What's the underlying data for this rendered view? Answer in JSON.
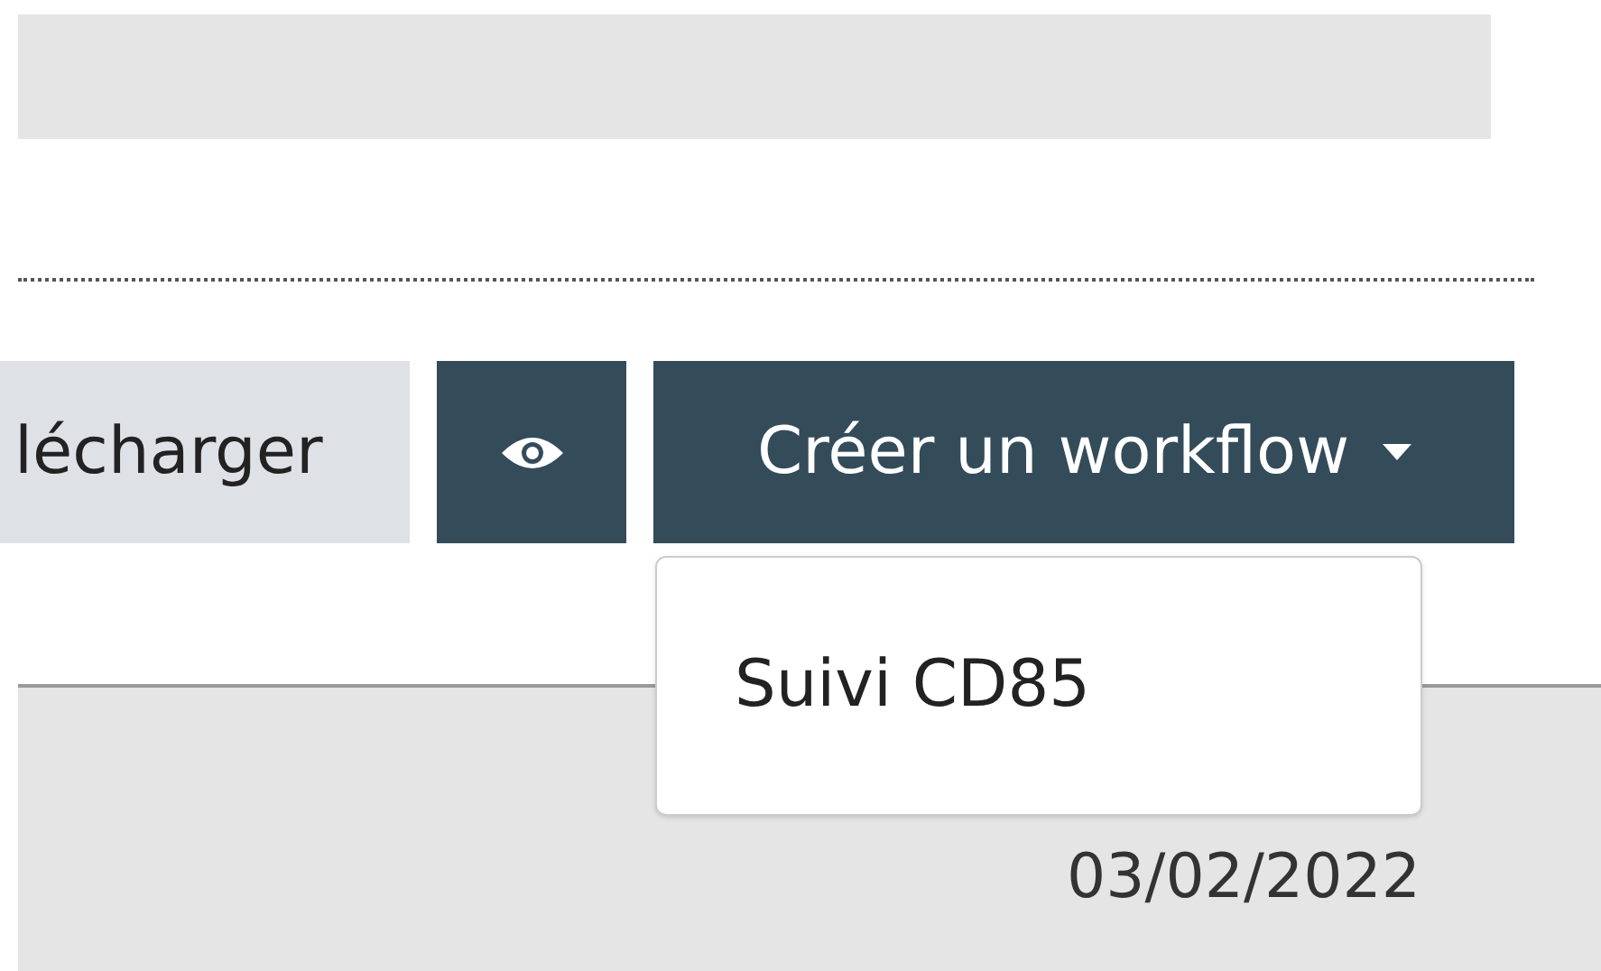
{
  "toolbar": {
    "buttons": [
      {
        "kind": "text",
        "label": "lécharger"
      },
      {
        "kind": "icon"
      },
      {
        "kind": "dropdown",
        "label": "Créer un workflow",
        "expanded": true
      }
    ]
  },
  "dropdown_menu": {
    "items": [
      "Suivi CD85"
    ]
  },
  "table": {
    "rows": [
      {
        "date": "03/02/2022"
      }
    ]
  }
}
